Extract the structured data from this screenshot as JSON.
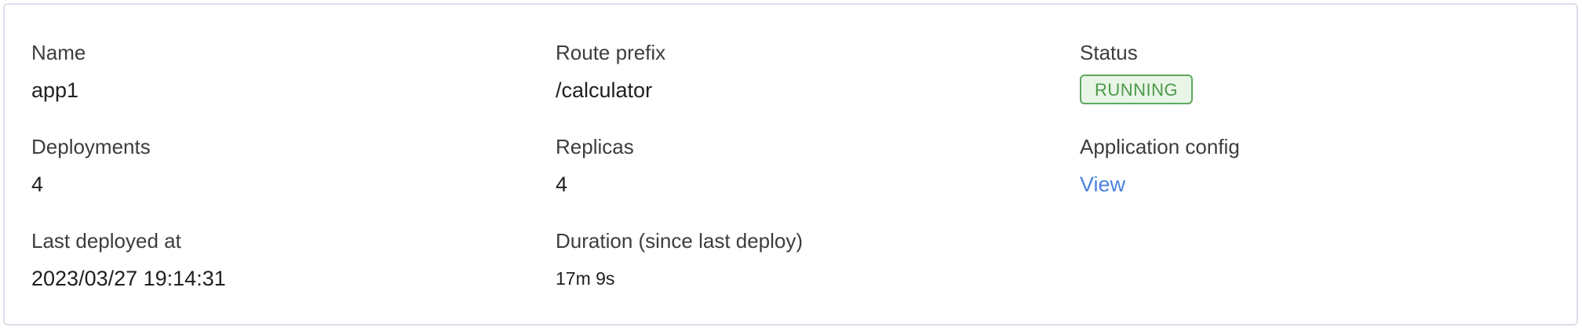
{
  "details": {
    "name": {
      "label": "Name",
      "value": "app1"
    },
    "route_prefix": {
      "label": "Route prefix",
      "value": "/calculator"
    },
    "status": {
      "label": "Status",
      "value": "RUNNING",
      "badge_color": "#5fa85f"
    },
    "deployments": {
      "label": "Deployments",
      "value": "4"
    },
    "replicas": {
      "label": "Replicas",
      "value": "4"
    },
    "application_config": {
      "label": "Application config",
      "link_label": "View",
      "link_color": "#4a82e0"
    },
    "last_deployed_at": {
      "label": "Last deployed at",
      "value": "2023/03/27 19:14:31"
    },
    "duration": {
      "label": "Duration (since last deploy)",
      "value": "17m 9s"
    }
  }
}
